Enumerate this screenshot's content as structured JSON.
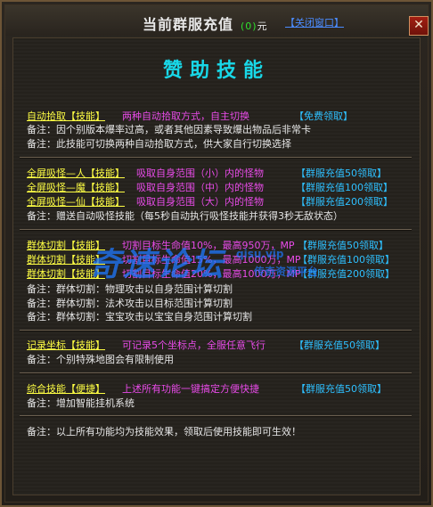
{
  "window": {
    "title": "当前群服充值",
    "balance": "(0)",
    "unit": "元",
    "close_link": "【关闭窗口】",
    "close_symbol": "✕"
  },
  "heading": "赞助技能",
  "sections": [
    {
      "lines": [
        {
          "name": "自动拾取",
          "tag": "【技能】",
          "desc": "两种自动拾取方式，自主切换",
          "claim": "【免费领取】"
        },
        {
          "note": "备注：因个别版本爆率过高，或者其他因素导致爆出物品后非常卡"
        },
        {
          "note": "备注：此技能可切换两种自动拾取方式，供大家自行切换选择"
        }
      ]
    },
    {
      "lines": [
        {
          "name": "全屏吸怪—人",
          "tag": "【技能】",
          "desc": "吸取自身范围（小）内的怪物",
          "claim": "【群服充值50领取】"
        },
        {
          "name": "全屏吸怪—魔",
          "tag": "【技能】",
          "desc": "吸取自身范围（中）内的怪物",
          "claim": "【群服充值100领取】"
        },
        {
          "name": "全屏吸怪—仙",
          "tag": "【技能】",
          "desc": "吸取自身范围（大）内的怪物",
          "claim": "【群服充值200领取】"
        },
        {
          "note": "备注：赠送自动吸怪技能（每5秒自动执行吸怪技能并获得3秒无敌状态）"
        }
      ]
    },
    {
      "lines": [
        {
          "name": "群体切割",
          "tag": "【技能】",
          "desc": "切割目标生命值10%，最高950万，MP",
          "claim": "【群服充值50领取】"
        },
        {
          "name": "群体切割",
          "tag": "【技能】",
          "desc": "切割目标生命值15%，最高1000万，MP",
          "claim": "【群服充值100领取】"
        },
        {
          "name": "群体切割",
          "tag": "【技能】",
          "desc": "切割目标生命值20%，最高1000万，MP",
          "claim": "【群服充值200领取】"
        },
        {
          "note": "备注：群体切割：物理攻击以自身范围计算切割"
        },
        {
          "note": "备注：群体切割：法术攻击以目标范围计算切割"
        },
        {
          "note": "备注：群体切割：宝宝攻击以宝宝自身范围计算切割"
        }
      ]
    },
    {
      "lines": [
        {
          "name": "记录坐标",
          "tag": "【技能】",
          "desc": "可记录5个坐标点，全服任意飞行",
          "claim": "【群服充值50领取】"
        },
        {
          "note": "备注：个别特殊地图会有限制使用"
        }
      ]
    },
    {
      "lines": [
        {
          "name": "综合技能",
          "tag": "【便捷】",
          "desc": "上述所有功能一键搞定方便快捷",
          "claim": "【群服充值50领取】"
        },
        {
          "note": "备注：增加智能挂机系统"
        }
      ]
    },
    {
      "lines": [
        {
          "note": "备注：以上所有功能均为技能效果，领取后使用技能即可生效！"
        }
      ]
    }
  ],
  "watermark": {
    "main": "奇速论坛",
    "sub1": "qisu.vip",
    "sub2": "传奇资源平台"
  }
}
